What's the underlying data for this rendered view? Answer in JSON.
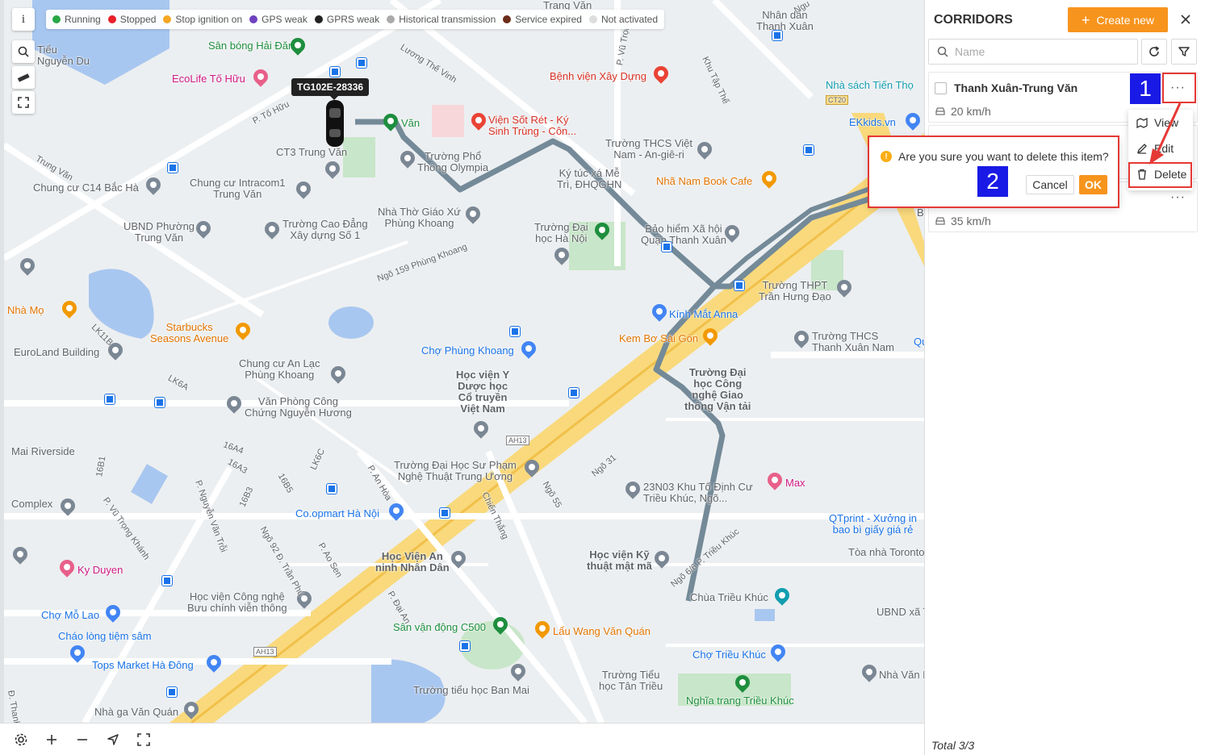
{
  "legend": [
    {
      "label": "Running",
      "color": "#28a745"
    },
    {
      "label": "Stopped",
      "color": "#e8202a"
    },
    {
      "label": "Stop ignition on",
      "color": "#f5a623"
    },
    {
      "label": "GPS weak",
      "color": "#6f42c1"
    },
    {
      "label": "GPRS weak",
      "color": "#222222"
    },
    {
      "label": "Historical transmission",
      "color": "#aaaaaa"
    },
    {
      "label": "Service expired",
      "color": "#6b2d1a"
    },
    {
      "label": "Not activated",
      "color": "#dddddd"
    }
  ],
  "map_controls": {
    "info_label": "i"
  },
  "vehicle": {
    "plate": "TG102E-28336"
  },
  "map_pois": [
    "Sân bóng Hải Đăng",
    "EcoLife Tố Hữu",
    "CT3 Trung Văn",
    "Chung cư C14 Bắc Hà",
    "Chung cư Intracom1\nTrung Văn",
    "UBND Phường\nTrung Văn",
    "Trường Cao Đẳng\nXây dựng Số 1",
    "Nhà Thờ Giáo Xứ\nPhùng Khoang",
    "Trường Đại\nhọc Hà Nội",
    "Bệnh viện Xây Dựng",
    "Viện Sốt Rét - Ký\nSinh Trùng - Côn...",
    "Trường Phổ\nThông Olympia",
    "Ký túc xá Mễ\nTrì, ĐHQGHN",
    "Trường THCS Việt\nNam - An-giê-ri",
    "Nhã Nam Book Cafe",
    "Bảo hiểm Xã hội\nQuận Thanh Xuân",
    "Trường THPT\nTrần Hưng Đạo",
    "Kính Mắt Anna",
    "Kem Bơ Sài Gòn",
    "Trường THCS\nThanh Xuân Nam",
    "Starbucks\nSeasons Avenue",
    "Chợ Phùng Khoang",
    "Chung cư An Lạc\nPhùng Khoang",
    "Văn Phòng Công\nChứng Nguyễn Hương",
    "Học viện Y\nDược học\nCổ truyền\nViệt Nam",
    "Trường Đại\nhọc Công\nnghệ Giao\nthông Vận tải",
    "Trường Đại Học Sư Phạm\nNghệ Thuật Trung Ương",
    "23N03 Khu Tố Định Cư\nTriều Khúc, Ngõ...",
    "Max",
    "Co.opmart Hà Nội",
    "Học Viện An\nninh Nhân Dân",
    "Học viện Kỹ\nthuật mật mã",
    "Học viện Công nghệ\nBưu chính viễn thông",
    "Chùa Triều Khúc",
    "Ky Duyen",
    "Chợ Mỗ Lao",
    "Cháo lòng tiệm sâm",
    "Tops Market Hà Đông",
    "Sân vận động C500",
    "Lẩu Wang Văn Quán",
    "Chợ Triều Khúc",
    "Trường Tiểu\nhọc Tân Triều",
    "Nghĩa trang Triều Khúc",
    "Trường tiểu học Ban Mai",
    "Nhà ga Văn Quán",
    "Mai Riverside",
    "Complex",
    "EuroLand Building",
    "Nhà Mọ",
    "Nhà sách Tiến Thọ",
    "EKkids.vn",
    "QTprint - Xưởng in\nbao bì giấy giá rẻ",
    "Tòa nhà Toronto",
    "UBND xã T",
    "Nhà Văn H",
    "Tiểu\nNguyễn Du",
    "Văn",
    "Trường Tiểu",
    "Nhân dân\nThanh Xuân",
    "Qu",
    "Bơ",
    "Vi",
    "Trang Văn"
  ],
  "map_streets": [
    "P. Tố Hữu",
    "Lương Thế Vinh",
    "Trung Văn",
    "P. Vũ Trọng",
    "Khu Tập Thể",
    "Ngõ 159 Phùng Khoang",
    "LK11B",
    "LK6A",
    "16A4",
    "16A3",
    "LK6C",
    "16B5",
    "16B3",
    "16B1",
    "P. Vũ Trọng Khánh",
    "P. Nguyễn Văn Trỗi",
    "P. An Hòa",
    "Ngõ 92 Đ. Trần Phú",
    "P. Ao Sen",
    "Chiến Thắng",
    "Ngõ 55",
    "Ngõ 31",
    "P. Đại An",
    "Ngõ 6/6 P. Triều Khúc",
    "Đ. Thanh Bình",
    "CT20",
    "AH13",
    "Ngu"
  ],
  "panel": {
    "title": "CORRIDORS",
    "create_label": "Create new",
    "search_placeholder": "Name",
    "total": "Total 3/3"
  },
  "corridors": [
    {
      "name": "Thanh Xuân-Trung Văn",
      "speed": "20 km/h"
    },
    {
      "name": "",
      "speed": ""
    },
    {
      "name": "",
      "speed": "35 km/h"
    }
  ],
  "menu": {
    "view": "View",
    "edit": "Edit",
    "delete": "Delete"
  },
  "confirm": {
    "message": "Are you sure you want to delete this item?",
    "cancel": "Cancel",
    "ok": "OK",
    "warn_icon": "!"
  },
  "annotations": {
    "step1": "1",
    "step2": "2"
  }
}
